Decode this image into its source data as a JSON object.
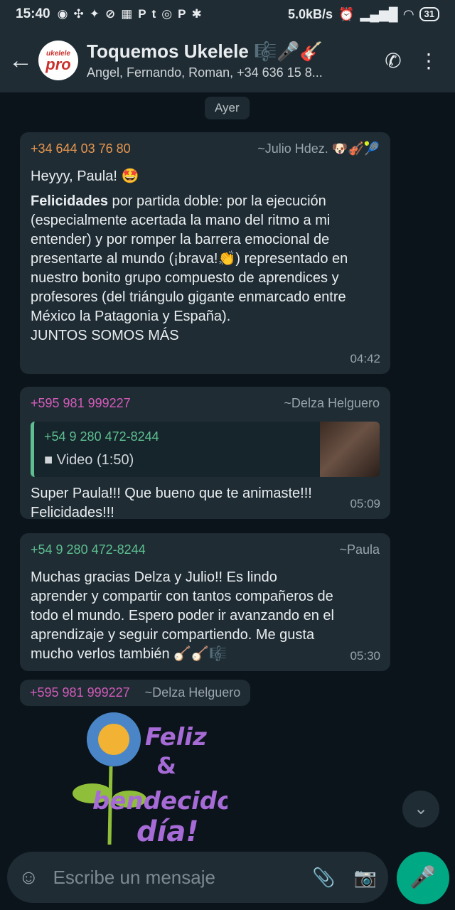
{
  "status_bar": {
    "time": "15:40",
    "network_speed": "5.0kB/s",
    "battery": "31",
    "left_icons": [
      "messenger-icon",
      "uu-icon",
      "twitter-icon",
      "steam-icon",
      "grid-icon",
      "pandora-icon",
      "tumblr-icon",
      "instagram-icon",
      "pandora-icon",
      "spotify-icon"
    ]
  },
  "header": {
    "avatar_top": "ukelele",
    "avatar_main": "pro",
    "title": "Toquemos Ukelele 🎼🎤🎸",
    "subtitle": "Angel, Fernando, Roman, +34 636 15 8..."
  },
  "date_pill": "Ayer",
  "messages": [
    {
      "phone": "+34 644 03 76 80",
      "alias": "~Julio Hdez. 🐶🎻🎾",
      "greeting": "Heyyy, Paula! 🤩",
      "bold": "Felicidades",
      "text1": " por partida doble: por la ejecución (especialmente acertada la mano del ritmo a mi entender) y por romper la barrera emocional de presentarte al mundo (¡brava!👏) representado en nuestro bonito grupo compuesto de aprendices y profesores (del triángulo gigante enmarcado entre México  la Patagonia y España).",
      "text2": "JUNTOS SOMOS MÁS",
      "time": "04:42"
    },
    {
      "phone": "+595 981 999227",
      "alias": "~Delza Helguero",
      "quote_name": "+54 9 280 472-8244",
      "quote_media": "Video (1:50)",
      "text": "Super Paula!!! Que bueno que te animaste!!! Felicidades!!!",
      "time": "05:09"
    },
    {
      "phone": "+54 9 280 472-8244",
      "alias": "~Paula",
      "text": "Muchas gracias Delza y Julio!! Es lindo aprender y compartir con tantos compañeros de todo el mundo. Espero poder ir avanzando en el aprendizaje y seguir compartiendo. Me gusta mucho verlos también 🪕🪕🎼",
      "time": "05:30"
    },
    {
      "phone": "+595 981 999227",
      "alias": "~Delza Helguero",
      "sticker_line1": "Feliz",
      "sticker_line2": "&",
      "sticker_line3": "bendecido",
      "sticker_line4": "día!"
    }
  ],
  "input": {
    "placeholder": "Escribe un mensaje"
  }
}
